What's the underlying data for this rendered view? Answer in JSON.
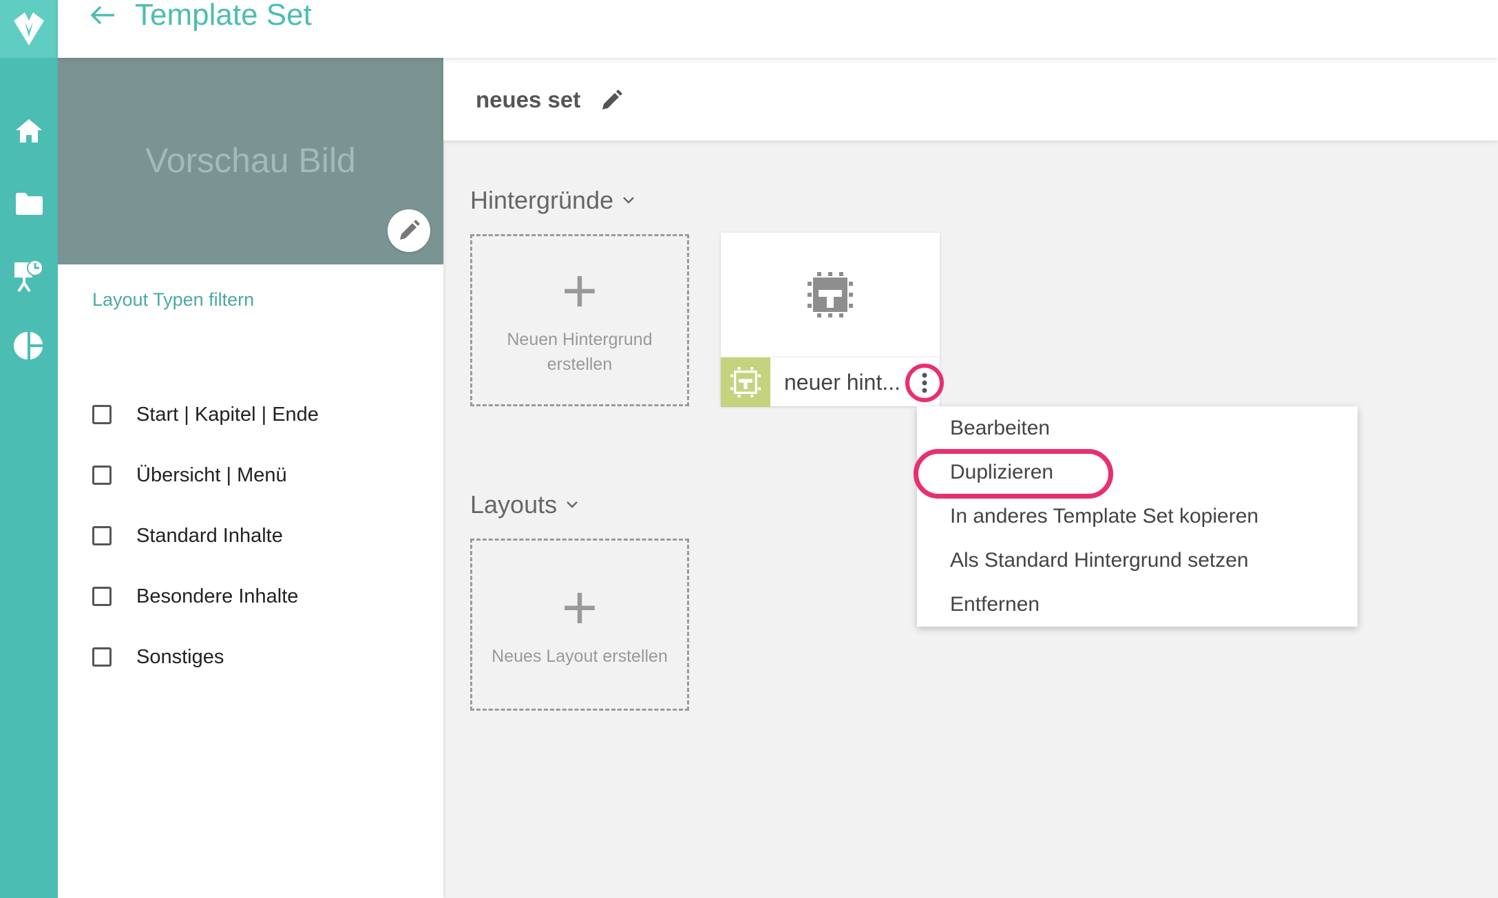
{
  "header": {
    "title": "Template Set"
  },
  "rail": {
    "icons": [
      "logo-icon",
      "home-icon",
      "folder-icon",
      "presentation-icon",
      "pie-chart-icon"
    ]
  },
  "preview": {
    "label": "Vorschau Bild"
  },
  "filters": {
    "title": "Layout Typen filtern",
    "items": [
      {
        "label": "Start | Kapitel | Ende",
        "checked": false
      },
      {
        "label": "Übersicht | Menü",
        "checked": false
      },
      {
        "label": "Standard Inhalte",
        "checked": false
      },
      {
        "label": "Besondere Inhalte",
        "checked": false
      },
      {
        "label": "Sonstiges",
        "checked": false
      }
    ]
  },
  "set": {
    "name": "neues set"
  },
  "backgrounds": {
    "title": "Hintergründe",
    "add_label": "Neuen Hintergrund erstellen",
    "items": [
      {
        "name": "neuer hint..."
      }
    ]
  },
  "layouts": {
    "title": "Layouts",
    "add_label": "Neues Layout erstellen"
  },
  "context_menu": {
    "items": [
      "Bearbeiten",
      "Duplizieren",
      "In anderes Template Set kopieren",
      "Als Standard Hintergrund setzen",
      "Entfernen"
    ],
    "highlighted": "Duplizieren"
  },
  "colors": {
    "accent": "#4cbdb2",
    "highlight": "#e8306e",
    "badge": "#c5d37f",
    "preview": "#7a9494"
  }
}
